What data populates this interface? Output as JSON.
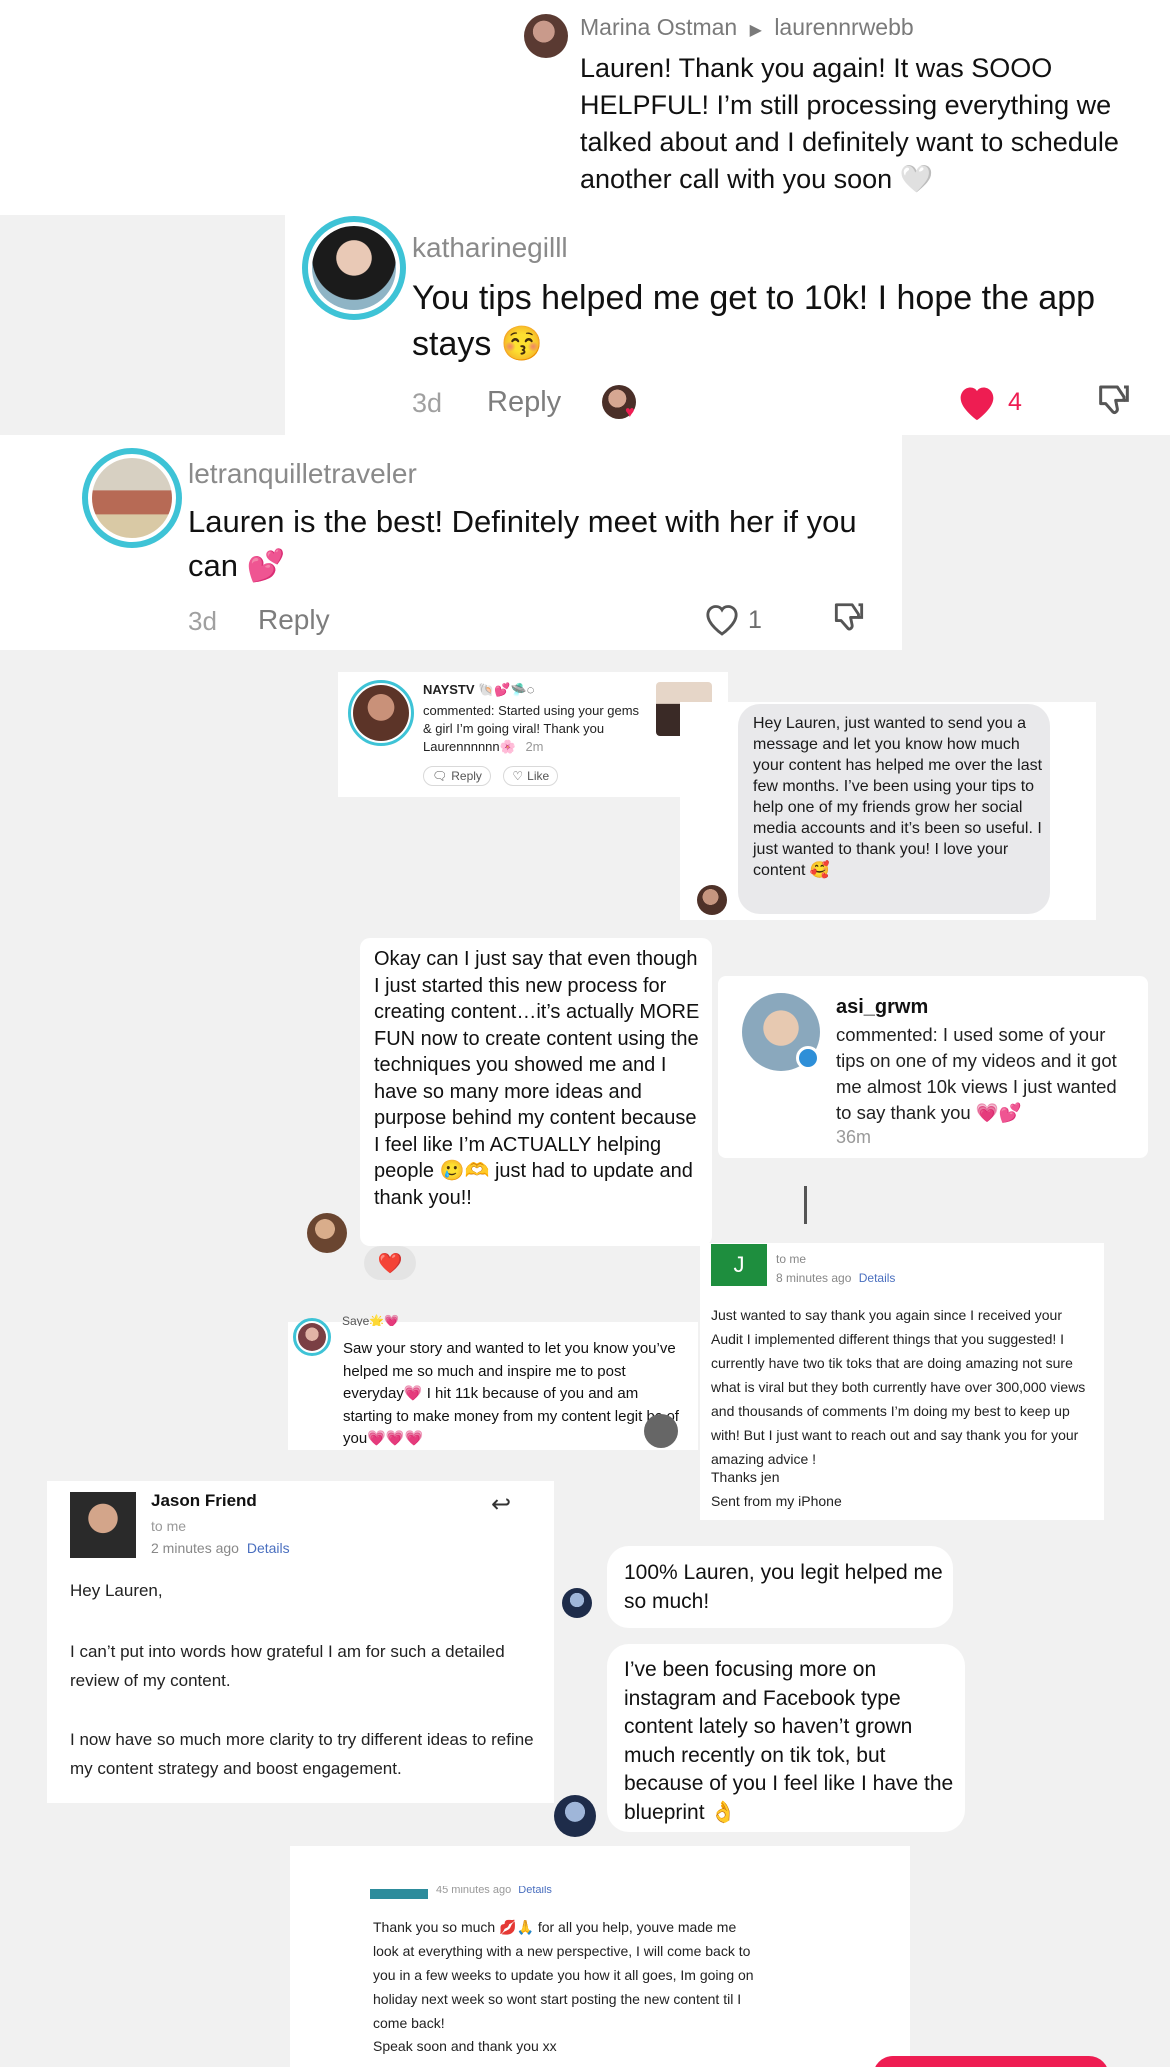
{
  "marina": {
    "user": "Marina Ostman",
    "recipient": "laurennrwebb",
    "text": "Lauren! Thank you again! It was SOOO HELPFUL! I’m still processing everything we talked about and I definitely want to schedule another call with you soon 🤍"
  },
  "katharine": {
    "user": "katharinegilll",
    "text": "You tips helped me get to 10k! I hope the app stays 😚",
    "time": "3d",
    "reply": "Reply",
    "likes": "4"
  },
  "letranquille": {
    "user": "letranquilletraveler",
    "text": "Lauren is the best! Definitely meet with her if you can 💕",
    "time": "3d",
    "reply": "Reply",
    "likes": "1"
  },
  "naystv": {
    "user": "NAYSTV 🐚💕🛸◌",
    "text": "commented: Started using your gems & girl I’m going viral! Thank you Laurennnnnn🌸",
    "time": "2m",
    "reply": "Reply",
    "like": "Like"
  },
  "dm_lauren": {
    "text": "Hey Lauren, just wanted to send you a message and let you know how much your content has helped me over the last few months. I’ve been using your tips to help one of my friends grow her social media accounts and it’s been so useful. I just wanted to thank you! I love your content 🥰"
  },
  "okay": {
    "text": "Okay can I just say that even though I just started this new process for creating content…it’s actually MORE FUN now to create content using the techniques you showed me and I have so many more ideas and purpose behind my content because I feel like I’m ACTUALLY helping people 🥲🫶 just had to update and thank you!!",
    "reaction": "❤️"
  },
  "asi": {
    "user": "asi_grwm",
    "text": "commented: I used some of your tips on one of my videos and it got me almost 10k views I just wanted to say thank you 💗💕",
    "time": "36m"
  },
  "jen_email": {
    "avatar_letter": "J",
    "to": "to me",
    "time": "8 minutes ago",
    "details": "Details",
    "body": "Just wanted to say thank you again since I received your Audit I implemented different things that you suggested! I currently have two tik toks that are doing amazing not sure what is viral but they both currently have over 300,000 views and thousands of comments I’m doing my best to keep up with! But I just want to reach out and say thank you for your amazing advice !",
    "signoff": "Thanks jen",
    "sent_from": "Sent from my iPhone"
  },
  "saye": {
    "user": "Saye🌟💗",
    "text": "Saw your story and wanted to let you know you’ve helped me so much and inspire me to post everyday💗 I hit 11k because of you and am starting to make money from my content legit bc of you💗💗💗"
  },
  "jason_email": {
    "sender": "Jason Friend",
    "to": "to me",
    "time": "2 minutes ago",
    "details": "Details",
    "greeting": "Hey Lauren,",
    "p1": "I can’t put into words how grateful I am for such a detailed review of my content.",
    "p2": "I now have so much more clarity to try different ideas to refine my content strategy and boost engagement."
  },
  "chat": {
    "msg1": "100% Lauren, you legit helped me so much!",
    "msg2": "I’ve been focusing more on instagram and Facebook type content lately so haven’t grown much recently on tik tok, but because of you I feel like I have the blueprint 👌"
  },
  "bottom_email": {
    "time": "45 minutes ago",
    "details": "Details",
    "body": "Thank you so much 💋🙏 for all you help, youve made me look at everything with a new perspective, I will come back to you in a few weeks to update you how it all goes, Im going on holiday next week so wont start posting the new content til I come back!",
    "signoff": "Speak soon and thank you xx"
  }
}
